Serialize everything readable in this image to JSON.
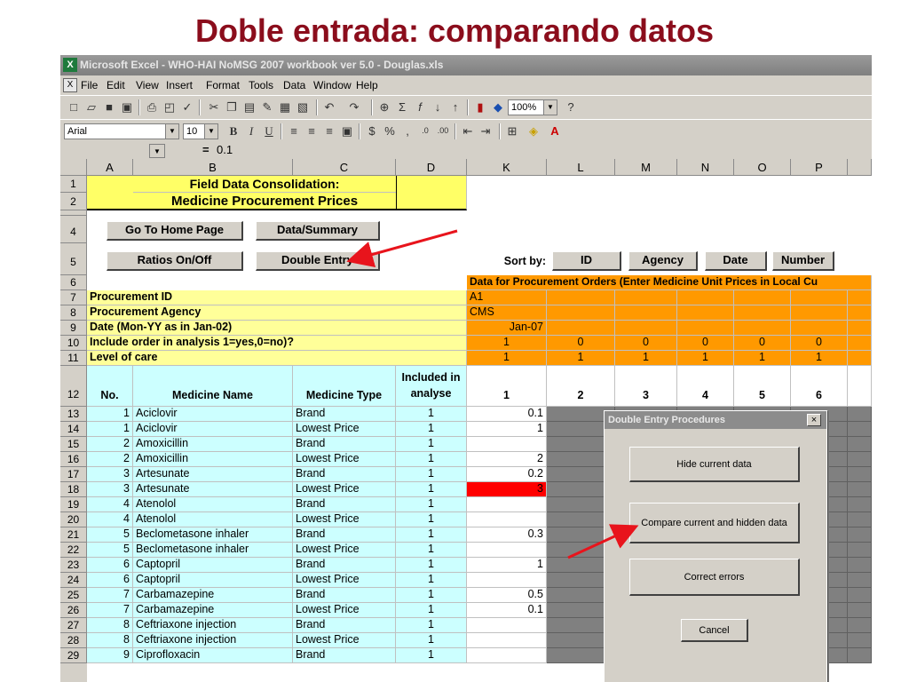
{
  "slide_title": "Doble entrada: comparando datos",
  "window": {
    "title": "Microsoft Excel - WHO-HAI NoMSG 2007 workbook ver 5.0 - Douglas.xls",
    "icon": "excel-icon"
  },
  "menu": [
    "File",
    "Edit",
    "View",
    "Insert",
    "Format",
    "Tools",
    "Data",
    "Window",
    "Help"
  ],
  "toolbar": {
    "zoom": "100%",
    "font": "Arial",
    "font_size": "10",
    "bold": "B",
    "italic": "I",
    "underline": "U"
  },
  "formula_bar": {
    "equals": "=",
    "value": "0.1"
  },
  "columns": [
    "A",
    "B",
    "C",
    "D",
    "K",
    "L",
    "M",
    "N",
    "O",
    "P"
  ],
  "header": {
    "title1": "Field Data Consolidation:",
    "title2": "Medicine Procurement Prices",
    "btn_home": "Go To Home Page",
    "btn_data_summary": "Data/Summary",
    "btn_ratios": "Ratios On/Off",
    "btn_double": "Double Entry",
    "sort_by": "Sort by:",
    "sort_buttons": [
      "ID",
      "Agency",
      "Date",
      "Number"
    ],
    "row6": "Data for Procurement Orders (Enter Medicine Unit Prices in Local Cu",
    "labels": {
      "r7": "Procurement ID",
      "r8": "Procurement Agency",
      "r9": "Date (Mon-YY as in Jan-02)",
      "r10": "Include order in analysis 1=yes,0=no)?",
      "r11": "Level of care"
    },
    "r7_value": "A1",
    "r8_value": "CMS",
    "r9_value": "Jan-07",
    "r10_values": [
      "1",
      "0",
      "0",
      "0",
      "0",
      "0"
    ],
    "r11_values": [
      "1",
      "1",
      "1",
      "1",
      "1",
      "1"
    ],
    "col_headers": {
      "no": "No.",
      "name": "Medicine Name",
      "type": "Medicine Type",
      "included": "Included in analyse"
    },
    "order_numbers": [
      "1",
      "2",
      "3",
      "4",
      "5",
      "6"
    ]
  },
  "rows": [
    {
      "row": "13",
      "no": "1",
      "name": "Aciclovir",
      "type": "Brand",
      "incl": "1",
      "k": "0.1"
    },
    {
      "row": "14",
      "no": "1",
      "name": "Aciclovir",
      "type": "Lowest Price",
      "incl": "1",
      "k": "1"
    },
    {
      "row": "15",
      "no": "2",
      "name": "Amoxicillin",
      "type": "Brand",
      "incl": "1",
      "k": ""
    },
    {
      "row": "16",
      "no": "2",
      "name": "Amoxicillin",
      "type": "Lowest Price",
      "incl": "1",
      "k": "2"
    },
    {
      "row": "17",
      "no": "3",
      "name": "Artesunate",
      "type": "Brand",
      "incl": "1",
      "k": "0.2"
    },
    {
      "row": "18",
      "no": "3",
      "name": "Artesunate",
      "type": "Lowest Price",
      "incl": "1",
      "k": "3"
    },
    {
      "row": "19",
      "no": "4",
      "name": "Atenolol",
      "type": "Brand",
      "incl": "1",
      "k": ""
    },
    {
      "row": "20",
      "no": "4",
      "name": "Atenolol",
      "type": "Lowest Price",
      "incl": "1",
      "k": ""
    },
    {
      "row": "21",
      "no": "5",
      "name": "Beclometasone inhaler",
      "type": "Brand",
      "incl": "1",
      "k": "0.3"
    },
    {
      "row": "22",
      "no": "5",
      "name": "Beclometasone inhaler",
      "type": "Lowest Price",
      "incl": "1",
      "k": ""
    },
    {
      "row": "23",
      "no": "6",
      "name": "Captopril",
      "type": "Brand",
      "incl": "1",
      "k": "1"
    },
    {
      "row": "24",
      "no": "6",
      "name": "Captopril",
      "type": "Lowest Price",
      "incl": "1",
      "k": ""
    },
    {
      "row": "25",
      "no": "7",
      "name": "Carbamazepine",
      "type": "Brand",
      "incl": "1",
      "k": "0.5"
    },
    {
      "row": "26",
      "no": "7",
      "name": "Carbamazepine",
      "type": "Lowest Price",
      "incl": "1",
      "k": "0.1"
    },
    {
      "row": "27",
      "no": "8",
      "name": "Ceftriaxone injection",
      "type": "Brand",
      "incl": "1",
      "k": ""
    },
    {
      "row": "28",
      "no": "8",
      "name": "Ceftriaxone injection",
      "type": "Lowest Price",
      "incl": "1",
      "k": ""
    },
    {
      "row": "29",
      "no": "9",
      "name": "Ciprofloxacin",
      "type": "Brand",
      "incl": "1",
      "k": ""
    }
  ],
  "row_headers_top": [
    "1",
    "2",
    "3",
    "4",
    "5",
    "6",
    "7",
    "8",
    "9",
    "10",
    "11",
    "12"
  ],
  "dialog": {
    "title": "Double Entry Procedures",
    "close": "×",
    "buttons": [
      "Hide current data",
      "Compare current and hidden data",
      "Correct errors",
      "Cancel"
    ]
  },
  "colors": {
    "title": "#8b0d1c",
    "header_yellow": "#ffff66",
    "orange": "#ff9900",
    "cyan": "#ccffff",
    "error_red": "#ff0000",
    "arrow": "#e8141c"
  }
}
